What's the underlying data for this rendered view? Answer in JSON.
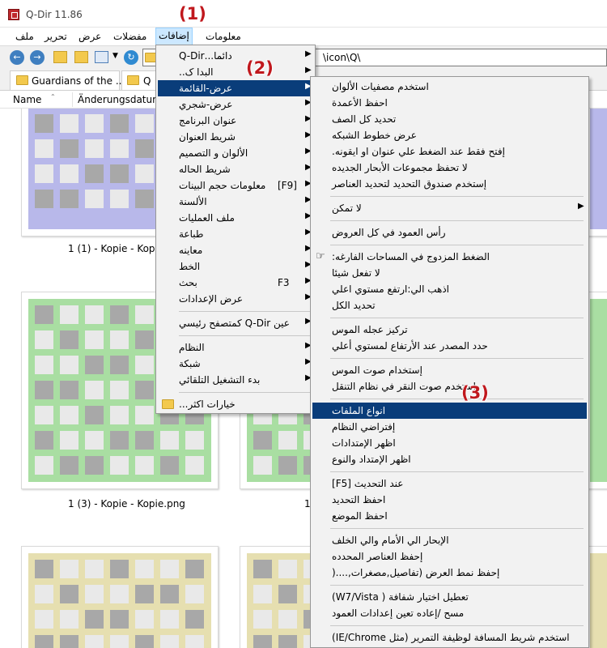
{
  "window": {
    "title": "Q-Dir 11.86"
  },
  "menubar": {
    "items": [
      "ملف",
      "تحرير",
      "عرض",
      "مفضلات",
      "إضافات",
      "معلومات"
    ]
  },
  "toolbar": {
    "address": "\\icon\\Q\\"
  },
  "tabs": [
    {
      "label": "Guardians of the ..."
    },
    {
      "label": "Q"
    }
  ],
  "columns": [
    "Name",
    "Änderungsdatum"
  ],
  "thumbnails": [
    {
      "caption": "1 (1) - Kopie - Kopie.",
      "color": "#b8b8ea"
    },
    {
      "caption": "",
      "color": "#b8b8ea"
    },
    {
      "caption": "1 (3) - Kopie - Kopie.png",
      "color": "#a9dea2"
    },
    {
      "caption": "1",
      "color": "#a9dea2"
    },
    {
      "caption": "",
      "color": "#e6dfb0"
    },
    {
      "caption": "",
      "color": "#e6dfb0"
    }
  ],
  "callouts": [
    "(1)",
    "(2)",
    "(3)"
  ],
  "menu_level1": {
    "items": [
      {
        "label": "دائما...Q-Dir",
        "arrow": true
      },
      {
        "label": "البدا ک..",
        "arrow": true
      },
      {
        "label": "عرض-القائمة",
        "arrow": true,
        "highlighted": true
      },
      {
        "label": "عرض-شجري",
        "arrow": true
      },
      {
        "label": "عنوان البرنامج",
        "arrow": true
      },
      {
        "label": "شريط العنوان",
        "arrow": true
      },
      {
        "label": "الألوان و التصميم",
        "arrow": true
      },
      {
        "label": "شريط الحاله",
        "arrow": true
      },
      {
        "label": "معلومات حجم البينات",
        "shortcut": "[F9]",
        "arrow": true
      },
      {
        "label": "الألسنة",
        "arrow": true
      },
      {
        "label": "ملف العمليات",
        "arrow": true
      },
      {
        "label": "طباعة",
        "arrow": true
      },
      {
        "label": "معاينه",
        "arrow": true
      },
      {
        "label": "الخط",
        "arrow": true
      },
      {
        "label": "بحث",
        "shortcut": "F3",
        "arrow": true
      },
      {
        "label": "عرض الإعدادات",
        "arrow": true
      },
      {
        "separator": true
      },
      {
        "label": "عين Q-Dir كمتصفح رئيسي",
        "arrow": true
      },
      {
        "separator": true
      },
      {
        "label": "النظام",
        "arrow": true
      },
      {
        "label": "شبكة",
        "arrow": true
      },
      {
        "label": "بدء التشغيل التلقائي",
        "arrow": true
      },
      {
        "separator": true
      },
      {
        "label": "خيارات اكثر...",
        "arrow": false,
        "folder": true
      }
    ]
  },
  "menu_level2": {
    "items": [
      {
        "label": "استخدم مصفيات الألوان"
      },
      {
        "label": "احفظ الأعمدة"
      },
      {
        "label": "تحديد كل الصف"
      },
      {
        "label": "عرض خطوط الشبكه"
      },
      {
        "label": "إفتح فقط عند الضغط علي عنوان او ايقونه."
      },
      {
        "label": "لا تحفظ مجموعات الأبحار الجديده"
      },
      {
        "label": "إستخدم صندوق التحديد لتحديد العناصر"
      },
      {
        "separator": true
      },
      {
        "label": "لا تمكن",
        "arrow": true
      },
      {
        "separator": true
      },
      {
        "label": "رأس العمود في كل العروض"
      },
      {
        "separator": true
      },
      {
        "label": "الضغط المزدوج في المساحات الفارغه:",
        "hand": true
      },
      {
        "label": "لا تفعل شيئا"
      },
      {
        "label": "اذهب الي:ارتفع مستوي اعلي"
      },
      {
        "label": "تحديد الكل"
      },
      {
        "separator": true
      },
      {
        "label": "تركيز عجله الموس"
      },
      {
        "label": "حدد المصدر عند الأرتفاع لمستوي أعلي"
      },
      {
        "separator": true
      },
      {
        "label": "إستخدام صوت الموس"
      },
      {
        "label": "استخدم صوت النقر في نظام التنقل"
      },
      {
        "separator": true
      },
      {
        "label": "انواع الملفات",
        "highlighted": true
      },
      {
        "label": "إفتراضي النظام"
      },
      {
        "label": "اظهر الإمتدادات"
      },
      {
        "label": "اظهر الإمتداد والنوع"
      },
      {
        "separator": true
      },
      {
        "label": "عند التحديث [F5]"
      },
      {
        "label": "احفظ التحديد"
      },
      {
        "label": "احفظ الموضع"
      },
      {
        "separator": true
      },
      {
        "label": "الإبحار الي الأمام والي الخلف"
      },
      {
        "label": "إحفظ العناصر المحدده"
      },
      {
        "label": "إحفظ نمط العرض (تفاصيل,مصغرات,....("
      },
      {
        "separator": true
      },
      {
        "label": "تعطيل اختيار شفافة ( W7/Vista)"
      },
      {
        "label": "مسح /إعاده تعين إعدادات العمود"
      },
      {
        "separator": true
      },
      {
        "label": "استخدم شريط المسافة لوظيفة التمرير (مثل IE/Chrome)"
      }
    ]
  },
  "colors": {
    "menu_highlight": "#0a3d7a",
    "menu_background": "#f2f2f2",
    "callout": "#c0181d",
    "menubar_active": "#cce8ff"
  }
}
